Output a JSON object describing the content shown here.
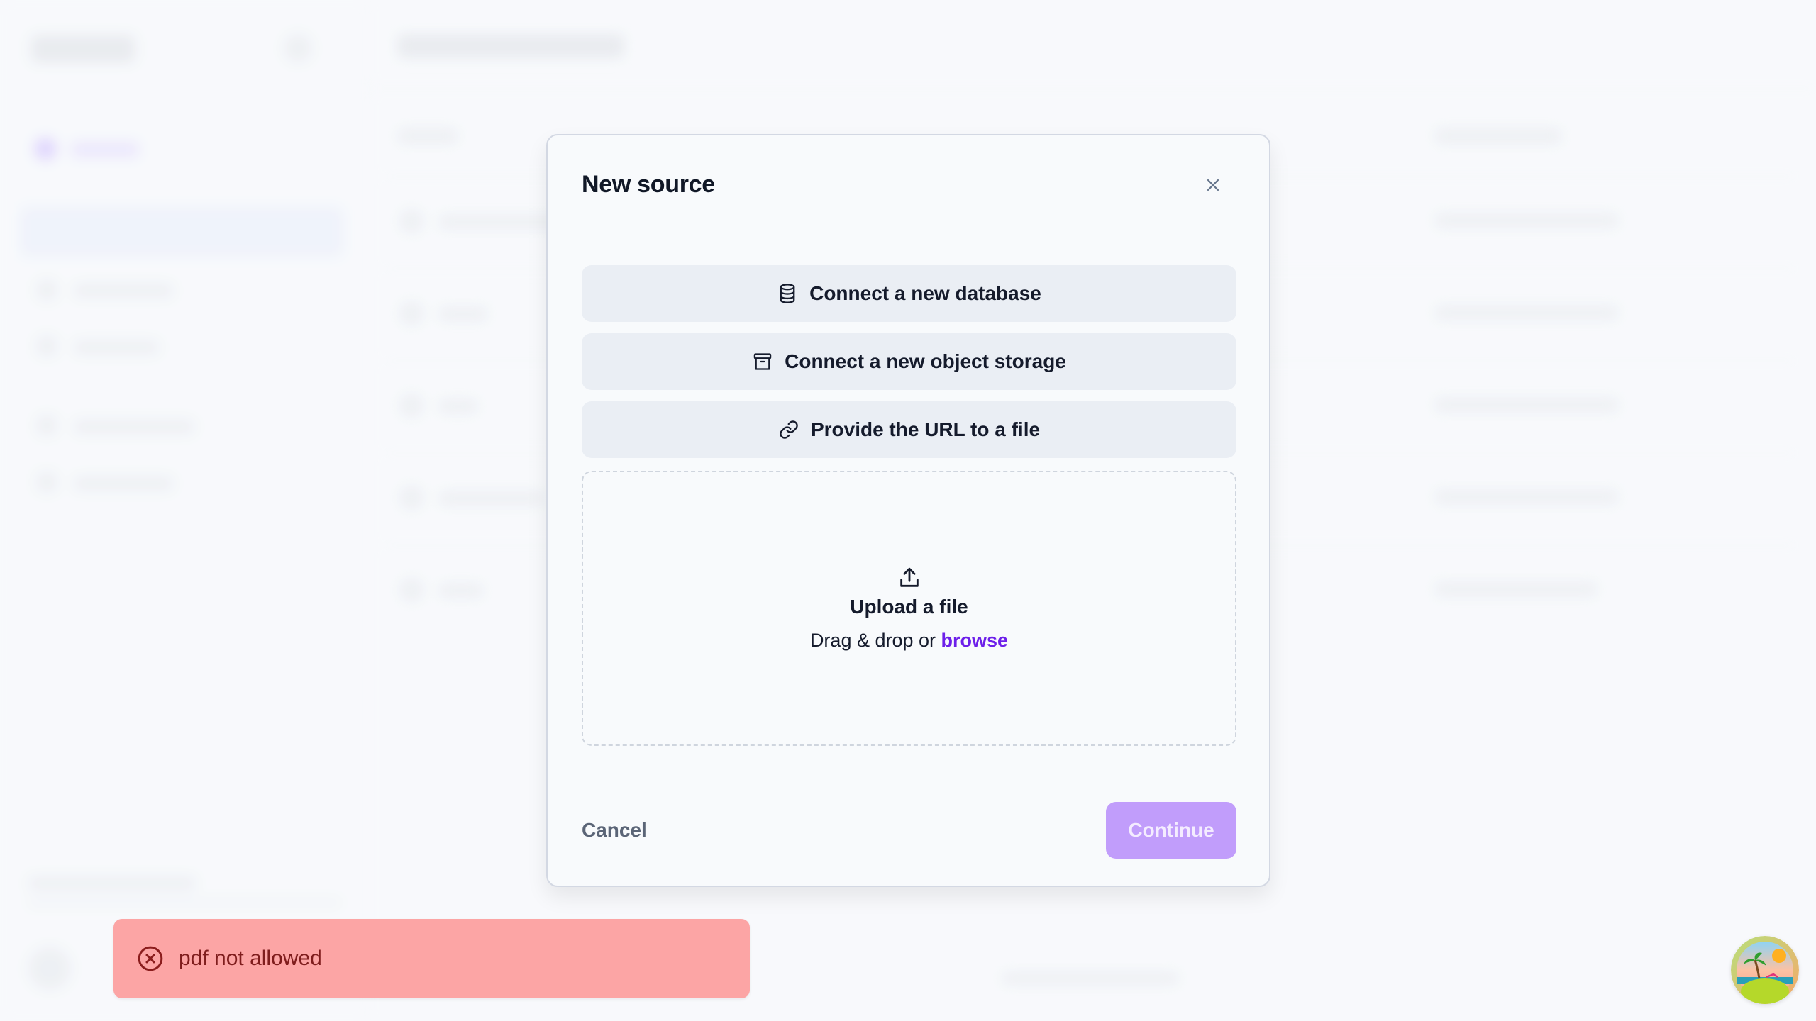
{
  "modal": {
    "title": "New source",
    "close_icon": "close-icon",
    "options": [
      {
        "label": "Connect a new database",
        "icon": "database-icon"
      },
      {
        "label": "Connect a new object storage",
        "icon": "archive-box-icon"
      },
      {
        "label": "Provide the URL to a file",
        "icon": "link-icon"
      }
    ],
    "upload": {
      "icon": "upload-icon",
      "title": "Upload a file",
      "subtitle_prefix": "Drag & drop or ",
      "browse_label": "browse"
    },
    "cancel_label": "Cancel",
    "continue_label": "Continue",
    "continue_disabled": true
  },
  "toast": {
    "type": "error",
    "icon": "x-circle-icon",
    "message": "pdf not allowed"
  },
  "colors": {
    "accent": "#6d1fea",
    "continue_disabled_bg": "#c19dfb",
    "option_bg": "#eaeef4",
    "toast_bg": "#fca5a5",
    "toast_text": "#7f1d1d"
  },
  "user": {
    "avatar_icon": "tropical-island-avatar"
  }
}
